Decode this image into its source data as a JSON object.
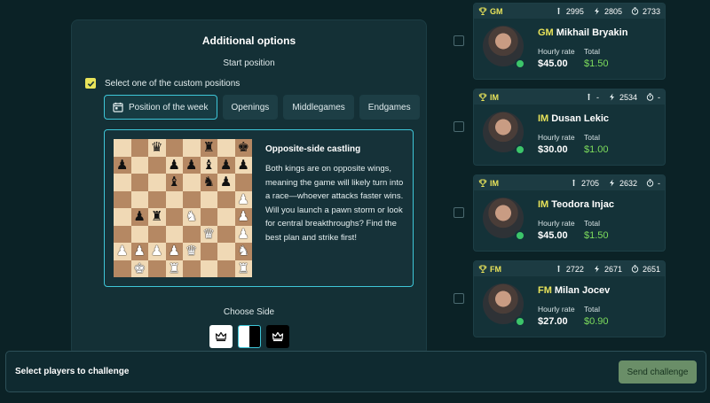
{
  "options": {
    "title": "Additional options",
    "start_position_label": "Start position",
    "custom_positions_label": "Select one of the custom positions",
    "custom_positions_checked": true,
    "tabs": [
      {
        "label": "Position of the week",
        "active": true
      },
      {
        "label": "Openings",
        "active": false
      },
      {
        "label": "Middlegames",
        "active": false
      },
      {
        "label": "Endgames",
        "active": false
      }
    ],
    "position": {
      "title": "Opposite-side castling",
      "description": "Both kings are on opposite wings, meaning the game will likely turn into a race—whoever attacks faster wins. Will you launch a pawn storm or look for central breakthroughs? Find the best plan and strike first!",
      "board_ranks": [
        "  q  r k",
        "p  ppbpp",
        "   b np ",
        "       P",
        " pr N  P",
        "     Q P",
        "PPPPQ  N",
        " K R   R"
      ]
    },
    "choose_side_label": "Choose Side",
    "sides": [
      "white",
      "random",
      "black"
    ],
    "selected_side": "random"
  },
  "players": [
    {
      "title": "GM",
      "name": "Mikhail Bryakin",
      "ratings": {
        "classical": "2995",
        "blitz": "2805",
        "rapid": "2733"
      },
      "hourly_rate_label": "Hourly rate",
      "hourly_rate": "$45.00",
      "total_label": "Total",
      "total": "$1.50",
      "online": true
    },
    {
      "title": "IM",
      "name": "Dusan Lekic",
      "ratings": {
        "classical": "-",
        "blitz": "2534",
        "rapid": "-"
      },
      "hourly_rate_label": "Hourly rate",
      "hourly_rate": "$30.00",
      "total_label": "Total",
      "total": "$1.00",
      "online": true
    },
    {
      "title": "IM",
      "name": "Teodora Injac",
      "ratings": {
        "classical": "2705",
        "blitz": "2632",
        "rapid": "-"
      },
      "hourly_rate_label": "Hourly rate",
      "hourly_rate": "$45.00",
      "total_label": "Total",
      "total": "$1.50",
      "online": true
    },
    {
      "title": "FM",
      "name": "Milan Jocev",
      "ratings": {
        "classical": "2722",
        "blitz": "2671",
        "rapid": "2651"
      },
      "hourly_rate_label": "Hourly rate",
      "hourly_rate": "$27.00",
      "total_label": "Total",
      "total": "$0.90",
      "online": true
    }
  ],
  "bottom_bar": {
    "label": "Select players to challenge",
    "send_button": "Send challenge"
  },
  "colors": {
    "background": "#0b2226",
    "accent_cyan": "#3ec6d8",
    "title_yellow": "#e8e35a",
    "total_green": "#7ddc5c",
    "online_green": "#3cc56a"
  }
}
